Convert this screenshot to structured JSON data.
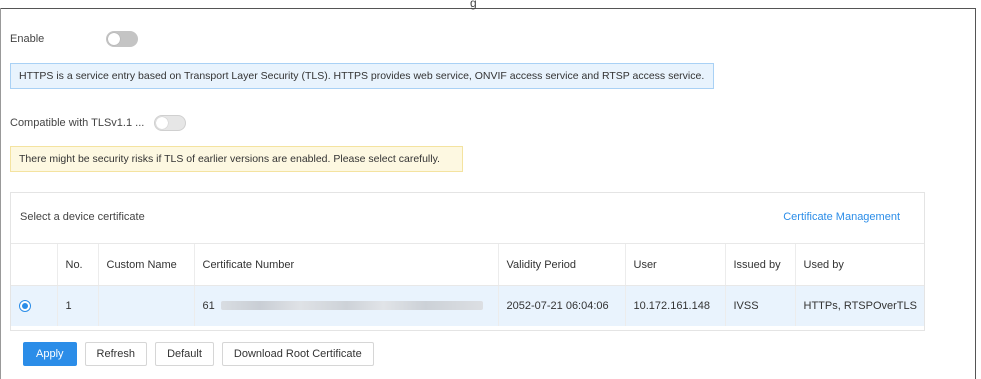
{
  "top_cut_text": "g",
  "enable": {
    "label": "Enable",
    "on": false
  },
  "info_message": "HTTPS is a service entry based on Transport Layer Security (TLS). HTTPS provides web service, ONVIF access service and RTSP access service.",
  "compat": {
    "label": "Compatible with TLSv1.1 ...",
    "on": false
  },
  "warning_message": "There might be security risks if TLS of earlier versions are enabled. Please select carefully.",
  "certificate": {
    "title": "Select a device certificate",
    "management_link": "Certificate Management",
    "columns": [
      "No.",
      "Custom Name",
      "Certificate Number",
      "Validity Period",
      "User",
      "Issued by",
      "Used by"
    ],
    "rows": [
      {
        "selected": true,
        "no": "1",
        "custom_name": "",
        "cert_number": "61",
        "validity": "2052-07-21 06:04:06",
        "user": "10.172.161.148",
        "issued_by": "IVSS",
        "used_by": "HTTPs, RTSPOverTLS"
      }
    ]
  },
  "buttons": {
    "apply": "Apply",
    "refresh": "Refresh",
    "default": "Default",
    "download_root": "Download Root Certificate"
  },
  "colors": {
    "accent": "#2b8de8",
    "info_bg": "#e8f3fd",
    "warning_bg": "#fdf8e1",
    "selected_row_bg": "#e9f3fd"
  }
}
